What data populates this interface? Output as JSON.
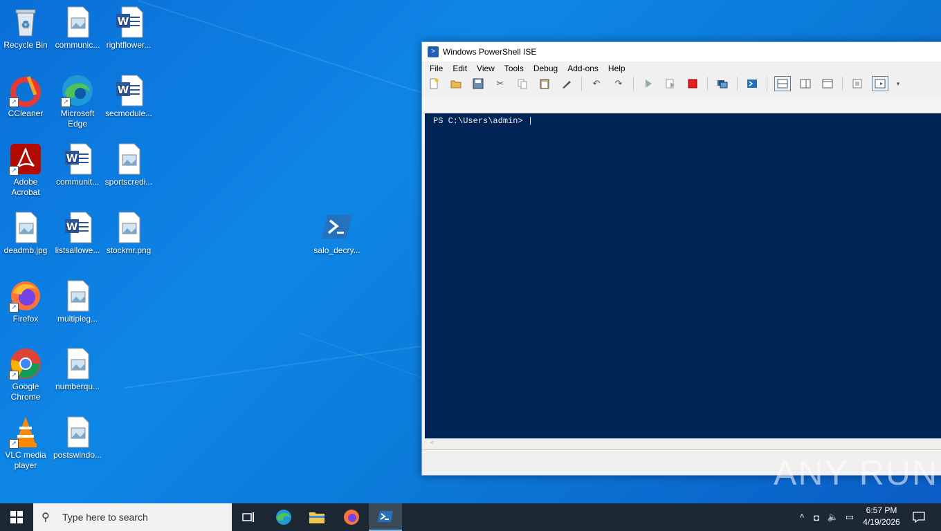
{
  "desktop": {
    "icons": [
      {
        "label": "Recycle Bin",
        "icon": "recycle-bin-icon"
      },
      {
        "label": "communic...",
        "icon": "image-file-icon"
      },
      {
        "label": "rightflower...",
        "icon": "word-doc-icon"
      },
      {
        "label": "CCleaner",
        "icon": "ccleaner-icon"
      },
      {
        "label": "Microsoft Edge",
        "icon": "edge-icon"
      },
      {
        "label": "secmodule...",
        "icon": "word-doc-icon"
      },
      {
        "label": "Adobe Acrobat",
        "icon": "acrobat-icon"
      },
      {
        "label": "communit...",
        "icon": "word-doc-icon"
      },
      {
        "label": "sportscredi...",
        "icon": "image-file-icon"
      },
      {
        "label": "deadmb.jpg",
        "icon": "image-file-icon"
      },
      {
        "label": "listsallowe...",
        "icon": "word-doc-icon"
      },
      {
        "label": "stockmr.png",
        "icon": "image-file-icon"
      },
      {
        "label": "Firefox",
        "icon": "firefox-icon"
      },
      {
        "label": "multipleg...",
        "icon": "image-file-icon"
      },
      {
        "label": "Google Chrome",
        "icon": "chrome-icon"
      },
      {
        "label": "numberqu...",
        "icon": "image-file-icon"
      },
      {
        "label": "VLC media player",
        "icon": "vlc-icon"
      },
      {
        "label": "postswindo...",
        "icon": "image-file-icon"
      },
      {
        "label": "salo_decry...",
        "icon": "powershell-script-icon"
      }
    ]
  },
  "window": {
    "title": "Windows PowerShell ISE",
    "menu": [
      "File",
      "Edit",
      "View",
      "Tools",
      "Debug",
      "Add-ons",
      "Help"
    ],
    "console_prompt": "PS C:\\Users\\admin> |",
    "scroll_glyph": "<"
  },
  "taskbar": {
    "search_placeholder": "Type here to search",
    "time": "6:57 PM",
    "date": "4/19/2026"
  },
  "watermark": "ANY RUN",
  "colors": {
    "desktop": "#0a78d8",
    "console_bg": "#012456",
    "taskbar": "#1c2833"
  }
}
